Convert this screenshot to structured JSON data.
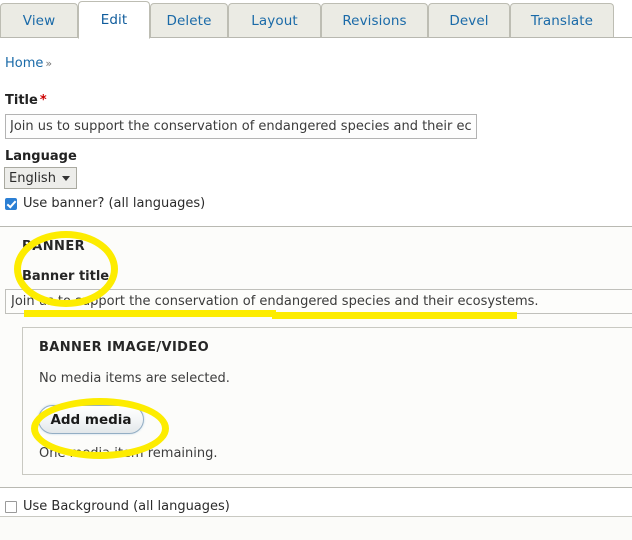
{
  "tabs": [
    {
      "label": "View",
      "active": false
    },
    {
      "label": "Edit",
      "active": true
    },
    {
      "label": "Delete",
      "active": false
    },
    {
      "label": "Layout",
      "active": false
    },
    {
      "label": "Revisions",
      "active": false
    },
    {
      "label": "Devel",
      "active": false
    },
    {
      "label": "Translate",
      "active": false
    }
  ],
  "breadcrumb": {
    "home_label": "Home",
    "separator": "»"
  },
  "form": {
    "title_label": "Title",
    "title_required_marker": "*",
    "title_value": "Join us to support the conservation of endangered species and their ecosystems.",
    "language_label": "Language",
    "language_value": "English",
    "use_banner_label": "Use banner? (all languages)",
    "use_background_label": "Use Background (all languages)"
  },
  "banner": {
    "heading": "BANNER",
    "title_label": "Banner title",
    "title_value": "Join us to support the conservation of endangered species and their ecosystems.",
    "media": {
      "heading": "BANNER IMAGE/VIDEO",
      "empty_text": "No media items are selected.",
      "add_button_label": "Add media",
      "remaining_text": "One media item remaining."
    }
  },
  "annotations": {
    "highlight_color": "#fdec00",
    "items": [
      {
        "kind": "ellipse",
        "target": "BANNER / Banner title labels"
      },
      {
        "kind": "underline",
        "target": "Banner title input"
      },
      {
        "kind": "ellipse",
        "target": "Add media button"
      }
    ]
  },
  "colors": {
    "tab_link": "#1a6aa8",
    "active_tab_bg": "#ffffff",
    "inactive_tab_bg": "#ebebe4",
    "required_star": "#cc0000",
    "checkbox_checked": "#2b7fd4",
    "group_bg": "#fcfcfa"
  }
}
